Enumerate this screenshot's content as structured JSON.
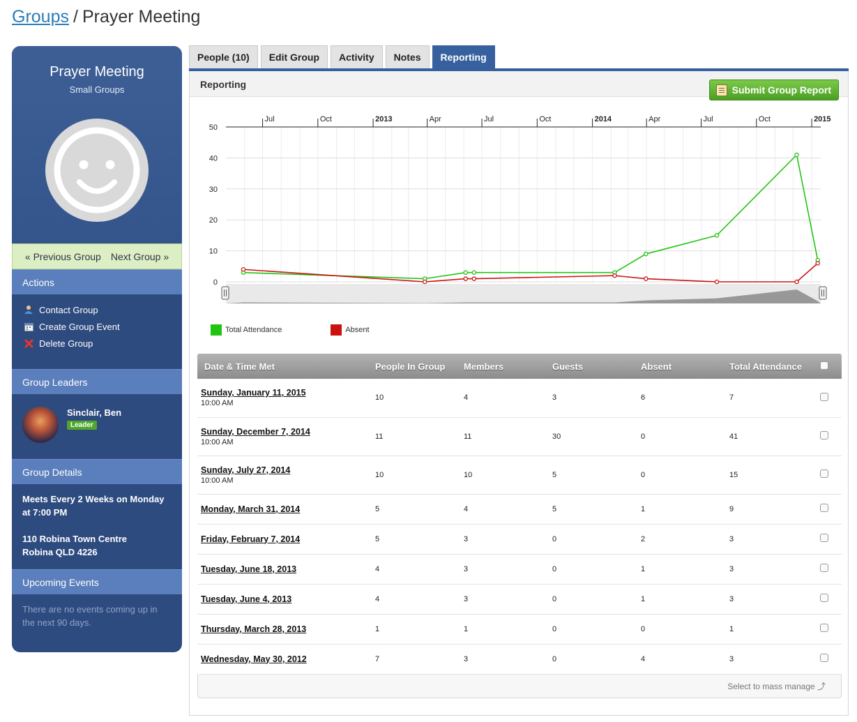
{
  "breadcrumb": {
    "root": "Groups",
    "separator": "/",
    "current": "Prayer Meeting"
  },
  "sidebar": {
    "group_name": "Prayer Meeting",
    "group_type": "Small Groups",
    "prev_label": "« Previous Group",
    "next_label": "Next Group »",
    "actions_title": "Actions",
    "actions": [
      {
        "label": "Contact Group",
        "icon": "contact-icon"
      },
      {
        "label": "Create Group Event",
        "icon": "calendar-icon"
      },
      {
        "label": "Delete Group",
        "icon": "delete-icon"
      }
    ],
    "leaders_title": "Group Leaders",
    "leader_name": "Sinclair, Ben",
    "leader_badge": "Leader",
    "details_title": "Group Details",
    "meets": "Meets Every 2 Weeks on Monday at 7:00 PM",
    "address1": "110 Robina Town Centre",
    "address2": "Robina QLD 4226",
    "upcoming_title": "Upcoming Events",
    "upcoming_text": "There are no events coming up in the next 90 days."
  },
  "tabs": [
    {
      "label": "People (10)",
      "active": false
    },
    {
      "label": "Edit Group",
      "active": false
    },
    {
      "label": "Activity",
      "active": false
    },
    {
      "label": "Notes",
      "active": false
    },
    {
      "label": "Reporting",
      "active": true
    }
  ],
  "panel": {
    "title": "Reporting",
    "submit_label": "Submit Group Report"
  },
  "colors": {
    "attendance": "#22c414",
    "absent": "#cc1111",
    "accent": "#36619e"
  },
  "chart_data": {
    "type": "line",
    "x_ticks": [
      "Jul",
      "Oct",
      "2013",
      "Apr",
      "Jul",
      "Oct",
      "2014",
      "Apr",
      "Jul",
      "Oct",
      "2015"
    ],
    "ylim": [
      0,
      50
    ],
    "y_ticks": [
      0,
      10,
      20,
      30,
      40,
      50
    ],
    "grid": true,
    "legend_position": "bottom-left",
    "x": [
      "2012-05-30",
      "2013-03-28",
      "2013-06-04",
      "2013-06-18",
      "2014-02-07",
      "2014-03-31",
      "2014-07-27",
      "2014-12-07",
      "2015-01-11"
    ],
    "series": [
      {
        "name": "Total Attendance",
        "values": [
          3,
          1,
          3,
          3,
          3,
          9,
          15,
          41,
          7
        ]
      },
      {
        "name": "Absent",
        "values": [
          4,
          0,
          1,
          1,
          2,
          1,
          0,
          0,
          6
        ]
      }
    ]
  },
  "table": {
    "headers": [
      "Date & Time Met",
      "People In Group",
      "Members",
      "Guests",
      "Absent",
      "Total Attendance"
    ],
    "rows": [
      {
        "date": "Sunday, January 11, 2015",
        "time": "10:00 AM",
        "people": "10",
        "members": "4",
        "guests": "3",
        "absent": "6",
        "total": "7"
      },
      {
        "date": "Sunday, December 7, 2014",
        "time": "10:00 AM",
        "people": "11",
        "members": "11",
        "guests": "30",
        "absent": "0",
        "total": "41"
      },
      {
        "date": "Sunday, July 27, 2014",
        "time": "10:00 AM",
        "people": "10",
        "members": "10",
        "guests": "5",
        "absent": "0",
        "total": "15"
      },
      {
        "date": "Monday, March 31, 2014",
        "time": "",
        "people": "5",
        "members": "4",
        "guests": "5",
        "absent": "1",
        "total": "9"
      },
      {
        "date": "Friday, February 7, 2014",
        "time": "",
        "people": "5",
        "members": "3",
        "guests": "0",
        "absent": "2",
        "total": "3"
      },
      {
        "date": "Tuesday, June 18, 2013",
        "time": "",
        "people": "4",
        "members": "3",
        "guests": "0",
        "absent": "1",
        "total": "3"
      },
      {
        "date": "Tuesday, June 4, 2013",
        "time": "",
        "people": "4",
        "members": "3",
        "guests": "0",
        "absent": "1",
        "total": "3"
      },
      {
        "date": "Thursday, March 28, 2013",
        "time": "",
        "people": "1",
        "members": "1",
        "guests": "0",
        "absent": "0",
        "total": "1"
      },
      {
        "date": "Wednesday, May 30, 2012",
        "time": "",
        "people": "7",
        "members": "3",
        "guests": "0",
        "absent": "4",
        "total": "3"
      }
    ],
    "footer": "Select to mass manage ⤴"
  }
}
